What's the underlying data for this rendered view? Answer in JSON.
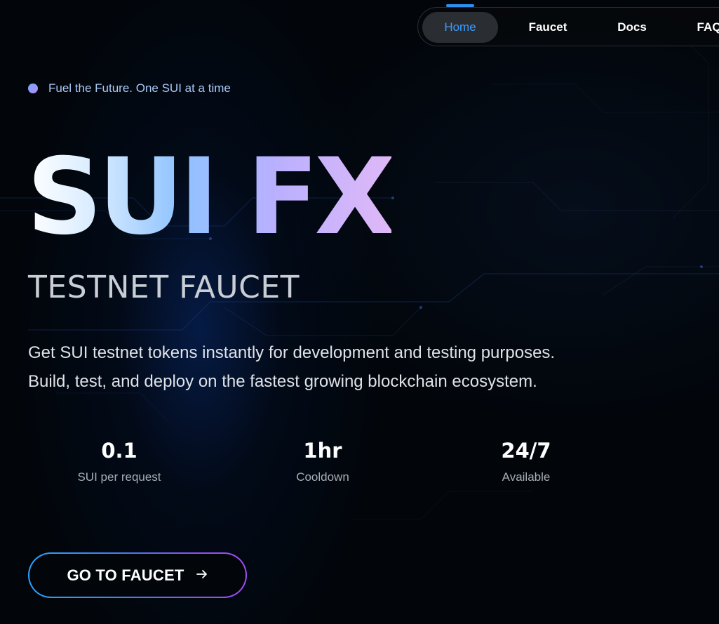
{
  "nav": {
    "items": [
      {
        "label": "Home",
        "active": true
      },
      {
        "label": "Faucet",
        "active": false
      },
      {
        "label": "Docs",
        "active": false
      },
      {
        "label": "FAQ",
        "active": false
      }
    ]
  },
  "hero": {
    "tagline": "Fuel the Future. One SUI at a time",
    "title": "SUI FX",
    "subtitle": "TESTNET FAUCET",
    "description": [
      "Get SUI testnet tokens instantly for development and testing purposes.",
      "Build, test, and deploy on the fastest growing blockchain ecosystem."
    ]
  },
  "stats": [
    {
      "value": "0.1",
      "label": "SUI per request"
    },
    {
      "value": "1hr",
      "label": "Cooldown"
    },
    {
      "value": "24/7",
      "label": "Available"
    }
  ],
  "cta": {
    "label": "GO TO FAUCET",
    "icon": "arrow-right-icon"
  },
  "colors": {
    "accent": "#3b9cff",
    "background": "#02060b",
    "gradient_start": "#2aa3ff",
    "gradient_end": "#a24cf5"
  }
}
